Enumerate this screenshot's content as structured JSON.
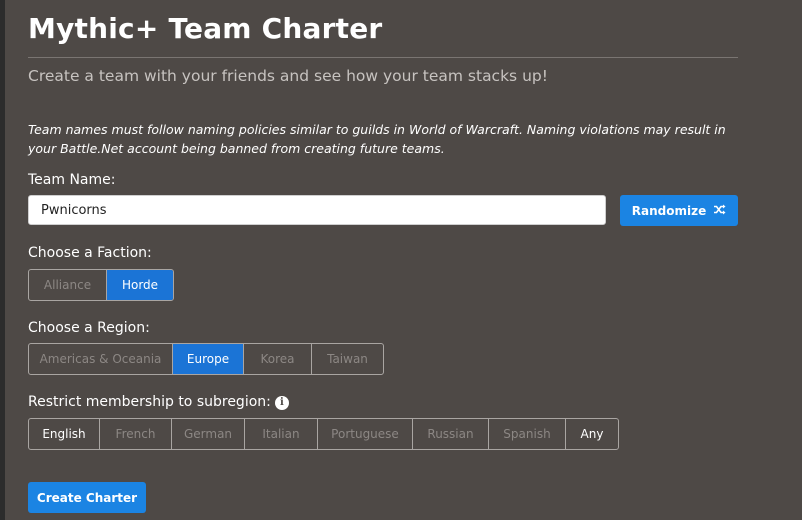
{
  "page": {
    "title": "Mythic+ Team Charter",
    "subtitle": "Create a team with your friends and see how your team stacks up!",
    "notice": "Team names must follow naming policies similar to guilds in World of Warcraft. Naming violations may result in your Battle.Net account being banned from creating future teams."
  },
  "team_name": {
    "label": "Team Name:",
    "value": "Pwnicorns",
    "randomize_label": "Randomize",
    "randomize_icon": "shuffle-icon"
  },
  "faction": {
    "label": "Choose a Faction:",
    "options": [
      "Alliance",
      "Horde"
    ],
    "selected": "Horde"
  },
  "region": {
    "label": "Choose a Region:",
    "options": [
      "Americas & Oceania",
      "Europe",
      "Korea",
      "Taiwan"
    ],
    "selected": "Europe"
  },
  "subregion": {
    "label": "Restrict membership to subregion:",
    "info_icon": "info-icon",
    "options": [
      "English",
      "French",
      "German",
      "Italian",
      "Portuguese",
      "Russian",
      "Spanish",
      "Any"
    ],
    "checked": [
      "English",
      "Any"
    ]
  },
  "actions": {
    "create_label": "Create Charter"
  },
  "colors": {
    "background": "#4e4946",
    "accent": "#1b84e3",
    "active_segment": "#1b74d6",
    "inactive_text": "#8c8784"
  }
}
